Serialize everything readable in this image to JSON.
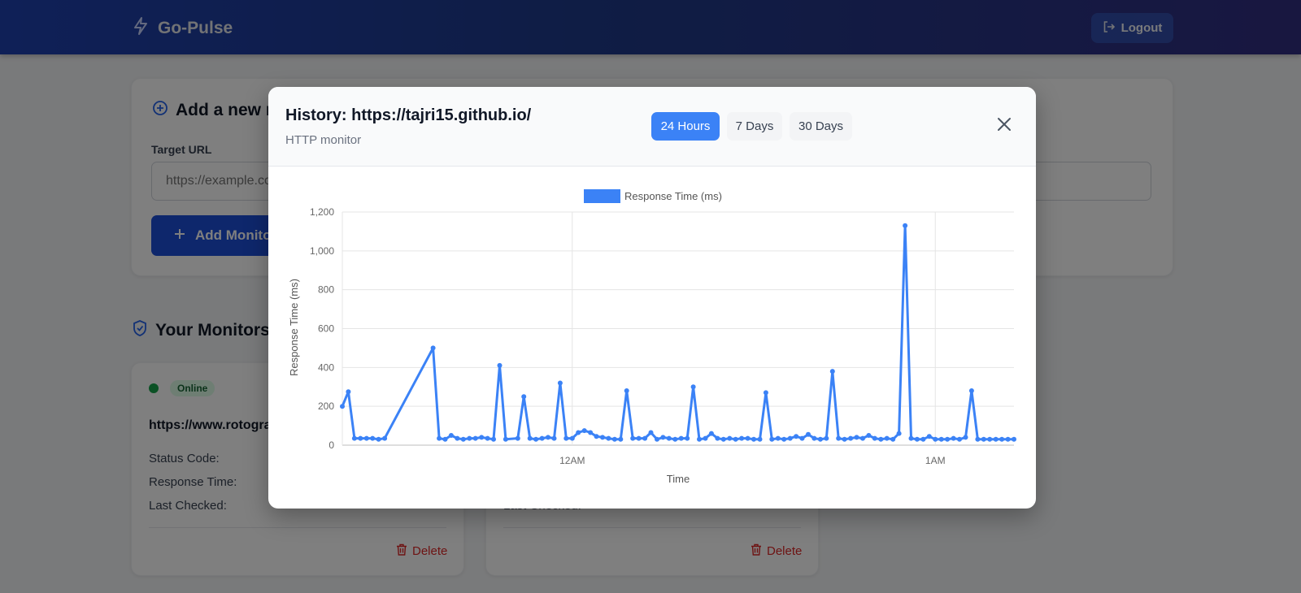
{
  "app": {
    "brand": "Go-Pulse",
    "logout_label": "Logout"
  },
  "add_monitor": {
    "title": "Add a new monitor",
    "field_label": "Target URL",
    "placeholder": "https://example.com",
    "button_label": "Add Monitor"
  },
  "monitors": {
    "title": "Your Monitors",
    "items": [
      {
        "status": "Online",
        "url": "https://www.rotograph.in/",
        "rows": [
          {
            "label": "Status Code:",
            "value": ""
          },
          {
            "label": "Response Time:",
            "value": ""
          },
          {
            "label": "Last Checked:",
            "value": ""
          }
        ],
        "delete_label": "Delete"
      },
      {
        "status": "",
        "url": "",
        "rows": [
          {
            "label": "",
            "value": ""
          },
          {
            "label": "",
            "value": ""
          },
          {
            "label": "Last Checked:",
            "value": ""
          }
        ],
        "delete_label": "Delete"
      }
    ]
  },
  "modal": {
    "title": "History: https://tajri15.github.io/",
    "subtitle": "HTTP monitor",
    "ranges": [
      {
        "label": "24 Hours",
        "active": true
      },
      {
        "label": "7 Days",
        "active": false
      },
      {
        "label": "30 Days",
        "active": false
      }
    ]
  },
  "colors": {
    "accent": "#3b82f6",
    "header_start": "#1e40af",
    "header_end": "#312e81",
    "online": "#16a34a",
    "danger": "#dc2626"
  },
  "icons": {
    "brand": "lightning-icon",
    "logout": "logout-icon",
    "add_section": "plus-circle-icon",
    "add_button": "plus-icon",
    "monitors_section": "shield-check-icon",
    "delete": "trash-icon",
    "close": "close-icon"
  },
  "chart_data": {
    "type": "line",
    "legend": [
      {
        "name": "Response Time (ms)",
        "color": "#3b82f6"
      }
    ],
    "legend_position": "top-center",
    "xlabel": "Time",
    "ylabel": "Response Time (ms)",
    "ylim": [
      0,
      1200
    ],
    "y_ticks": [
      "0",
      "200",
      "400",
      "600",
      "800",
      "1,000",
      "1,200"
    ],
    "x_range": [
      "23:22",
      "01:13"
    ],
    "x_ticks": [
      {
        "t": "00:00",
        "label": "12AM"
      },
      {
        "t": "01:00",
        "label": "1AM"
      }
    ],
    "grid": true,
    "series": [
      {
        "name": "Response Time (ms)",
        "x": [
          "23:22",
          "23:23",
          "23:24",
          "23:25",
          "23:26",
          "23:27",
          "23:28",
          "23:29",
          "23:37",
          "23:38",
          "23:39",
          "23:40",
          "23:41",
          "23:42",
          "23:43",
          "23:44",
          "23:45",
          "23:46",
          "23:47",
          "23:48",
          "23:49",
          "23:51",
          "23:52",
          "23:53",
          "23:54",
          "23:55",
          "23:56",
          "23:57",
          "23:58",
          "23:59",
          "00:00",
          "00:01",
          "00:02",
          "00:03",
          "00:04",
          "00:05",
          "00:06",
          "00:07",
          "00:08",
          "00:09",
          "00:10",
          "00:11",
          "00:12",
          "00:13",
          "00:14",
          "00:15",
          "00:16",
          "00:17",
          "00:18",
          "00:19",
          "00:20",
          "00:21",
          "00:22",
          "00:23",
          "00:24",
          "00:25",
          "00:26",
          "00:27",
          "00:28",
          "00:29",
          "00:30",
          "00:31",
          "00:32",
          "00:33",
          "00:34",
          "00:35",
          "00:36",
          "00:37",
          "00:38",
          "00:39",
          "00:40",
          "00:41",
          "00:42",
          "00:43",
          "00:44",
          "00:45",
          "00:46",
          "00:47",
          "00:48",
          "00:49",
          "00:50",
          "00:51",
          "00:52",
          "00:53",
          "00:54",
          "00:55",
          "00:56",
          "00:57",
          "00:58",
          "00:59",
          "01:00",
          "01:01",
          "01:02",
          "01:03",
          "01:04",
          "01:05",
          "01:06",
          "01:07",
          "01:08",
          "01:09",
          "01:10",
          "01:11",
          "01:12",
          "01:13"
        ],
        "y": [
          200,
          275,
          35,
          35,
          35,
          35,
          30,
          35,
          500,
          35,
          30,
          50,
          35,
          30,
          35,
          35,
          40,
          35,
          30,
          410,
          30,
          35,
          250,
          35,
          30,
          35,
          40,
          35,
          320,
          35,
          35,
          65,
          75,
          65,
          45,
          40,
          35,
          30,
          30,
          280,
          35,
          35,
          35,
          65,
          30,
          40,
          35,
          30,
          35,
          35,
          300,
          30,
          35,
          60,
          35,
          30,
          35,
          30,
          35,
          35,
          30,
          30,
          270,
          30,
          35,
          30,
          35,
          45,
          35,
          55,
          35,
          30,
          35,
          380,
          35,
          30,
          35,
          40,
          35,
          50,
          35,
          30,
          35,
          30,
          60,
          1130,
          35,
          30,
          30,
          45,
          30,
          30,
          30,
          35,
          30,
          40,
          280,
          30,
          30,
          30,
          30,
          30,
          30,
          30
        ]
      }
    ]
  }
}
